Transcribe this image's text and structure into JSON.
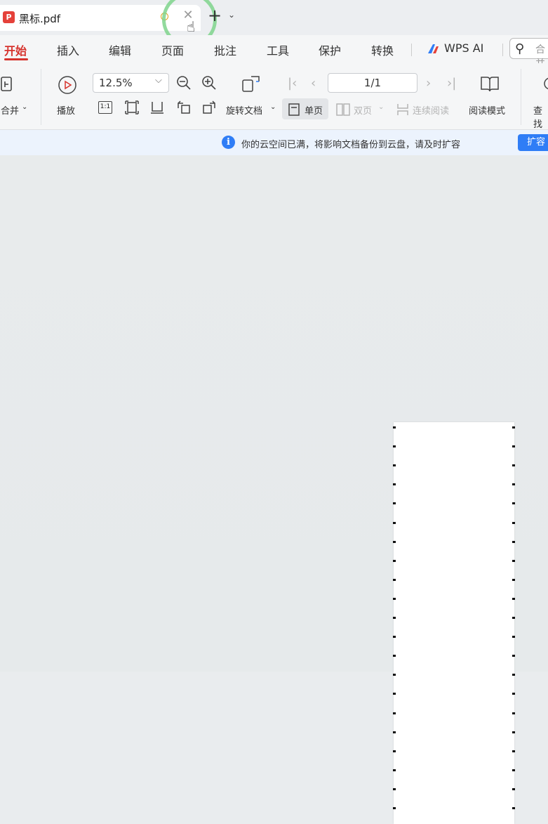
{
  "tab": {
    "title": "黑标.pdf",
    "pdf_icon": "pdf-icon",
    "close_icon": "close-icon",
    "new_tab": "+",
    "new_tab_menu": "⌄"
  },
  "menu": {
    "items": [
      "开始",
      "插入",
      "编辑",
      "页面",
      "批注",
      "工具",
      "保护",
      "转换"
    ],
    "active_index": 0,
    "ai_label": "WPS AI",
    "search_placeholder": "合并"
  },
  "toolbar": {
    "merge_label": "合并",
    "play_label": "播放",
    "zoom_value": "12.5%",
    "rotate_label": "旋转文档",
    "single_page_label": "单页",
    "double_page_label": "双页",
    "continuous_label": "连续阅读",
    "reading_mode_label": "阅读模式",
    "find_label": "查找",
    "page_value": "1/1",
    "actual_size_glyph": "1:1",
    "chevron": "⌄"
  },
  "notice": {
    "text": "你的云空间已满，将影响文档备份到云盘，请及时扩容",
    "button_label": "扩容"
  },
  "colors": {
    "accent_red": "#d6332d",
    "brand_blue": "#2f7df6",
    "pdf_red": "#e5413a"
  }
}
